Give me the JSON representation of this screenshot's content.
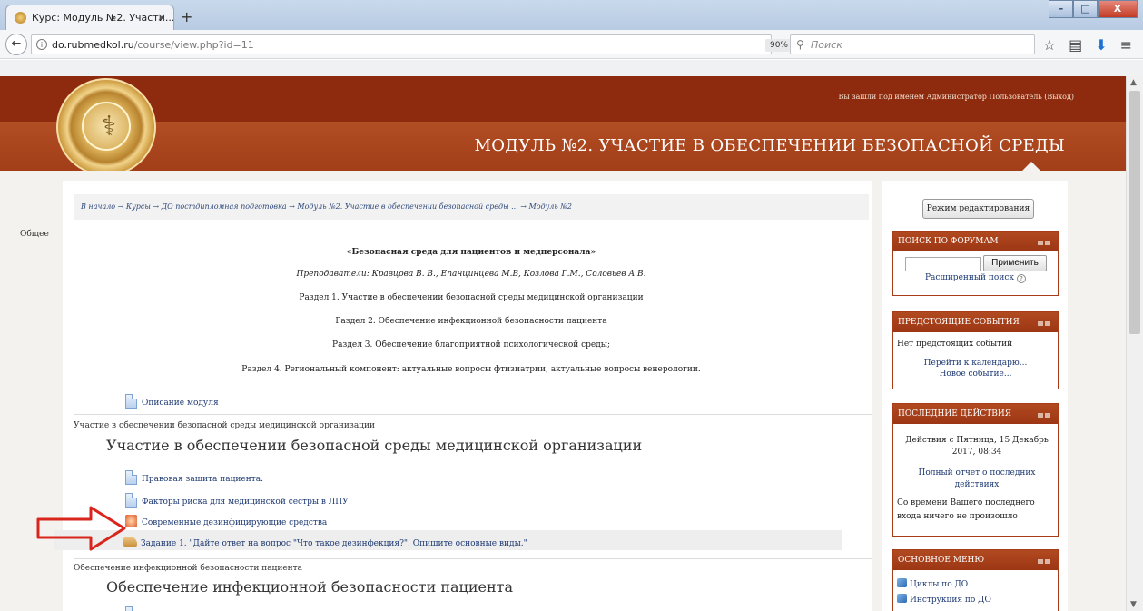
{
  "browser": {
    "tab_title": "Курс: Модуль №2. Участи...",
    "tab_close": "×",
    "new_tab": "+",
    "url_host": "do.rubmedkol.ru",
    "url_path": "/course/view.php?id=11",
    "zoom": "90%",
    "search_placeholder": "Поиск",
    "window_min": "–",
    "window_max": "□",
    "window_close": "X"
  },
  "header": {
    "login_info": "Вы зашли под именем Администратор Пользователь (Выход)",
    "course_title": "МОДУЛЬ №2. УЧАСТИЕ В ОБЕСПЕЧЕНИИ БЕЗОПАСНОЙ СРЕДЫ"
  },
  "breadcrumb": "В начало → Курсы → ДО постдипломная подготовка → Модуль №2. Участие в обеспечении безопасной среды ... → Модуль №2",
  "general": {
    "label": "Общее",
    "title": "«Безопасная среда для пациентов и медперсонала»",
    "teachers": "Преподаватели: Кравцова В. В., Епанцинцева М.В, Козлова Г.М.,  Соловьев А.В.",
    "sections": [
      "Раздел 1. Участие в обеспечении безопасной среды медицинской организации",
      "Раздел 2. Обеспечение инфекционной безопасности пациента",
      "Раздел 3. Обеспечение благоприятной психологической среды;",
      "Раздел 4. Региональный компонент: актуальные вопросы фтизиатрии, актуальные вопросы венерологии."
    ],
    "module_desc": "Описание модуля"
  },
  "section1": {
    "label": "Участие в обеспечении безопасной среды медицинской организации",
    "heading": "Участие в обеспечении безопасной среды медицинской организации",
    "items": [
      "Правовая защита пациента.",
      "Факторы риска для медицинской сестры в ЛПУ",
      "Современные дезинфицирующие средства",
      "Задание 1. \"Дайте ответ на вопрос \"Что такое дезинфекция?\". Опишите основные виды.\""
    ]
  },
  "section2": {
    "label": "Обеспечение инфекционной безопасности пациента",
    "heading": "Обеспечение инфекционной безопасности пациента"
  },
  "sidebar": {
    "edit_mode": "Режим редактирования",
    "forum_search": {
      "title": "ПОИСК ПО ФОРУМАМ",
      "apply": "Применить",
      "advanced": "Расширенный поиск"
    },
    "upcoming": {
      "title": "ПРЕДСТОЯЩИЕ СОБЫТИЯ",
      "none": "Нет предстоящих событий",
      "calendar": "Перейти к календарю...",
      "new_event": "Новое событие..."
    },
    "recent": {
      "title": "ПОСЛЕДНИЕ ДЕЙСТВИЯ",
      "since": "Действия с Пятница, 15 Декабрь 2017, 08:34",
      "full_report": "Полный отчет о последних действиях",
      "nothing": "Со времени Вашего последнего входа ничего не произошло"
    },
    "main_menu": {
      "title": "ОСНОВНОЕ МЕНЮ",
      "items": [
        "Циклы по ДО",
        "Инструкция по ДО"
      ]
    }
  },
  "colors": {
    "header_dark": "#8e2a0d",
    "header_accent": "#a83c18",
    "link": "#1e3a72",
    "arrow": "#d9261c"
  }
}
